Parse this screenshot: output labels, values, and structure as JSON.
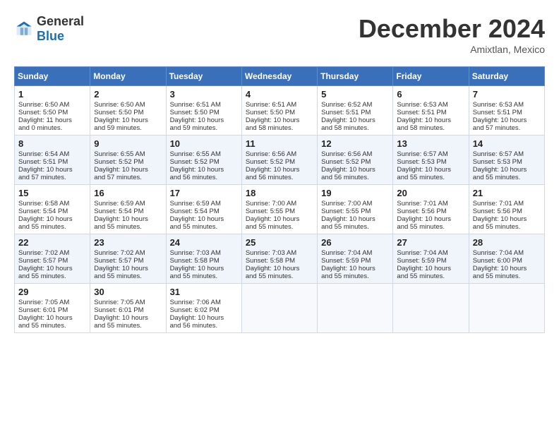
{
  "header": {
    "logo_general": "General",
    "logo_blue": "Blue",
    "title": "December 2024",
    "location": "Amixtlan, Mexico"
  },
  "calendar": {
    "days_of_week": [
      "Sunday",
      "Monday",
      "Tuesday",
      "Wednesday",
      "Thursday",
      "Friday",
      "Saturday"
    ],
    "weeks": [
      [
        null,
        null,
        null,
        null,
        null,
        null,
        null
      ]
    ],
    "cells": [
      {
        "day": 1,
        "col": 0,
        "sunrise": "6:50 AM",
        "sunset": "5:50 PM",
        "daylight": "11 hours and 0 minutes."
      },
      {
        "day": 2,
        "col": 1,
        "sunrise": "6:50 AM",
        "sunset": "5:50 PM",
        "daylight": "10 hours and 59 minutes."
      },
      {
        "day": 3,
        "col": 2,
        "sunrise": "6:51 AM",
        "sunset": "5:50 PM",
        "daylight": "10 hours and 59 minutes."
      },
      {
        "day": 4,
        "col": 3,
        "sunrise": "6:51 AM",
        "sunset": "5:50 PM",
        "daylight": "10 hours and 58 minutes."
      },
      {
        "day": 5,
        "col": 4,
        "sunrise": "6:52 AM",
        "sunset": "5:51 PM",
        "daylight": "10 hours and 58 minutes."
      },
      {
        "day": 6,
        "col": 5,
        "sunrise": "6:53 AM",
        "sunset": "5:51 PM",
        "daylight": "10 hours and 58 minutes."
      },
      {
        "day": 7,
        "col": 6,
        "sunrise": "6:53 AM",
        "sunset": "5:51 PM",
        "daylight": "10 hours and 57 minutes."
      },
      {
        "day": 8,
        "col": 0,
        "sunrise": "6:54 AM",
        "sunset": "5:51 PM",
        "daylight": "10 hours and 57 minutes."
      },
      {
        "day": 9,
        "col": 1,
        "sunrise": "6:55 AM",
        "sunset": "5:52 PM",
        "daylight": "10 hours and 57 minutes."
      },
      {
        "day": 10,
        "col": 2,
        "sunrise": "6:55 AM",
        "sunset": "5:52 PM",
        "daylight": "10 hours and 56 minutes."
      },
      {
        "day": 11,
        "col": 3,
        "sunrise": "6:56 AM",
        "sunset": "5:52 PM",
        "daylight": "10 hours and 56 minutes."
      },
      {
        "day": 12,
        "col": 4,
        "sunrise": "6:56 AM",
        "sunset": "5:52 PM",
        "daylight": "10 hours and 56 minutes."
      },
      {
        "day": 13,
        "col": 5,
        "sunrise": "6:57 AM",
        "sunset": "5:53 PM",
        "daylight": "10 hours and 55 minutes."
      },
      {
        "day": 14,
        "col": 6,
        "sunrise": "6:57 AM",
        "sunset": "5:53 PM",
        "daylight": "10 hours and 55 minutes."
      },
      {
        "day": 15,
        "col": 0,
        "sunrise": "6:58 AM",
        "sunset": "5:54 PM",
        "daylight": "10 hours and 55 minutes."
      },
      {
        "day": 16,
        "col": 1,
        "sunrise": "6:59 AM",
        "sunset": "5:54 PM",
        "daylight": "10 hours and 55 minutes."
      },
      {
        "day": 17,
        "col": 2,
        "sunrise": "6:59 AM",
        "sunset": "5:54 PM",
        "daylight": "10 hours and 55 minutes."
      },
      {
        "day": 18,
        "col": 3,
        "sunrise": "7:00 AM",
        "sunset": "5:55 PM",
        "daylight": "10 hours and 55 minutes."
      },
      {
        "day": 19,
        "col": 4,
        "sunrise": "7:00 AM",
        "sunset": "5:55 PM",
        "daylight": "10 hours and 55 minutes."
      },
      {
        "day": 20,
        "col": 5,
        "sunrise": "7:01 AM",
        "sunset": "5:56 PM",
        "daylight": "10 hours and 55 minutes."
      },
      {
        "day": 21,
        "col": 6,
        "sunrise": "7:01 AM",
        "sunset": "5:56 PM",
        "daylight": "10 hours and 55 minutes."
      },
      {
        "day": 22,
        "col": 0,
        "sunrise": "7:02 AM",
        "sunset": "5:57 PM",
        "daylight": "10 hours and 55 minutes."
      },
      {
        "day": 23,
        "col": 1,
        "sunrise": "7:02 AM",
        "sunset": "5:57 PM",
        "daylight": "10 hours and 55 minutes."
      },
      {
        "day": 24,
        "col": 2,
        "sunrise": "7:03 AM",
        "sunset": "5:58 PM",
        "daylight": "10 hours and 55 minutes."
      },
      {
        "day": 25,
        "col": 3,
        "sunrise": "7:03 AM",
        "sunset": "5:58 PM",
        "daylight": "10 hours and 55 minutes."
      },
      {
        "day": 26,
        "col": 4,
        "sunrise": "7:04 AM",
        "sunset": "5:59 PM",
        "daylight": "10 hours and 55 minutes."
      },
      {
        "day": 27,
        "col": 5,
        "sunrise": "7:04 AM",
        "sunset": "5:59 PM",
        "daylight": "10 hours and 55 minutes."
      },
      {
        "day": 28,
        "col": 6,
        "sunrise": "7:04 AM",
        "sunset": "6:00 PM",
        "daylight": "10 hours and 55 minutes."
      },
      {
        "day": 29,
        "col": 0,
        "sunrise": "7:05 AM",
        "sunset": "6:01 PM",
        "daylight": "10 hours and 55 minutes."
      },
      {
        "day": 30,
        "col": 1,
        "sunrise": "7:05 AM",
        "sunset": "6:01 PM",
        "daylight": "10 hours and 55 minutes."
      },
      {
        "day": 31,
        "col": 2,
        "sunrise": "7:06 AM",
        "sunset": "6:02 PM",
        "daylight": "10 hours and 56 minutes."
      }
    ]
  },
  "labels": {
    "sunrise": "Sunrise:",
    "sunset": "Sunset:",
    "daylight": "Daylight:"
  }
}
